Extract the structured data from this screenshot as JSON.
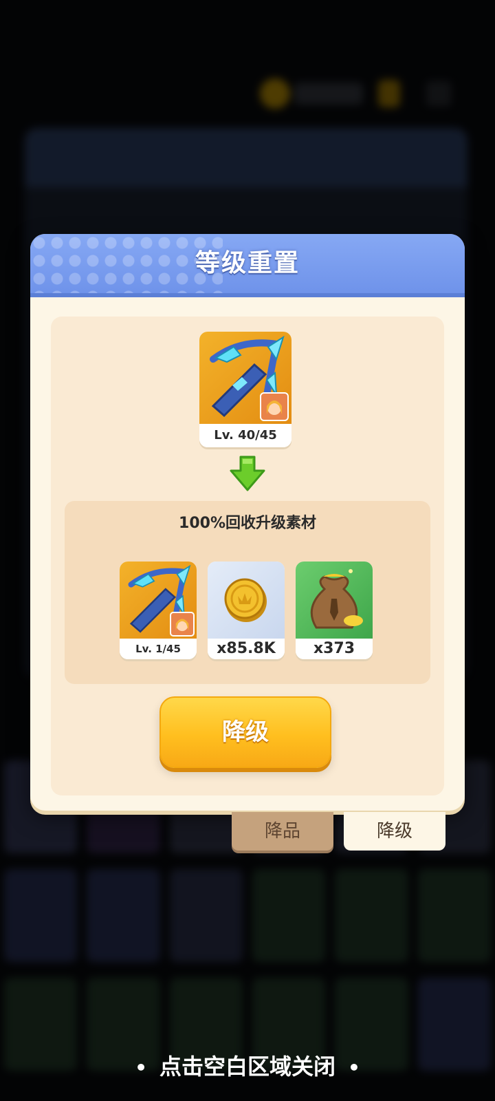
{
  "modal": {
    "title": "等级重置",
    "current_item": {
      "level": "Lv. 40/45",
      "icon": "crossbow-icon",
      "hero_icon": "hero-portrait-icon"
    },
    "recycle": {
      "title": "100%回收升级素材",
      "items": [
        {
          "label": "Lv. 1/45",
          "icon": "crossbow-icon"
        },
        {
          "label": "x85.8K",
          "icon": "gold-coin-icon"
        },
        {
          "label": "x373",
          "icon": "material-bag-icon"
        }
      ]
    },
    "action_button": "降级"
  },
  "tabs": {
    "quality": "降品",
    "level": "降级"
  },
  "close_hint": "点击空白区域关闭",
  "colors": {
    "header": "#86a8f4",
    "button": "#ffbf1f",
    "panel": "#fdf6e6"
  }
}
